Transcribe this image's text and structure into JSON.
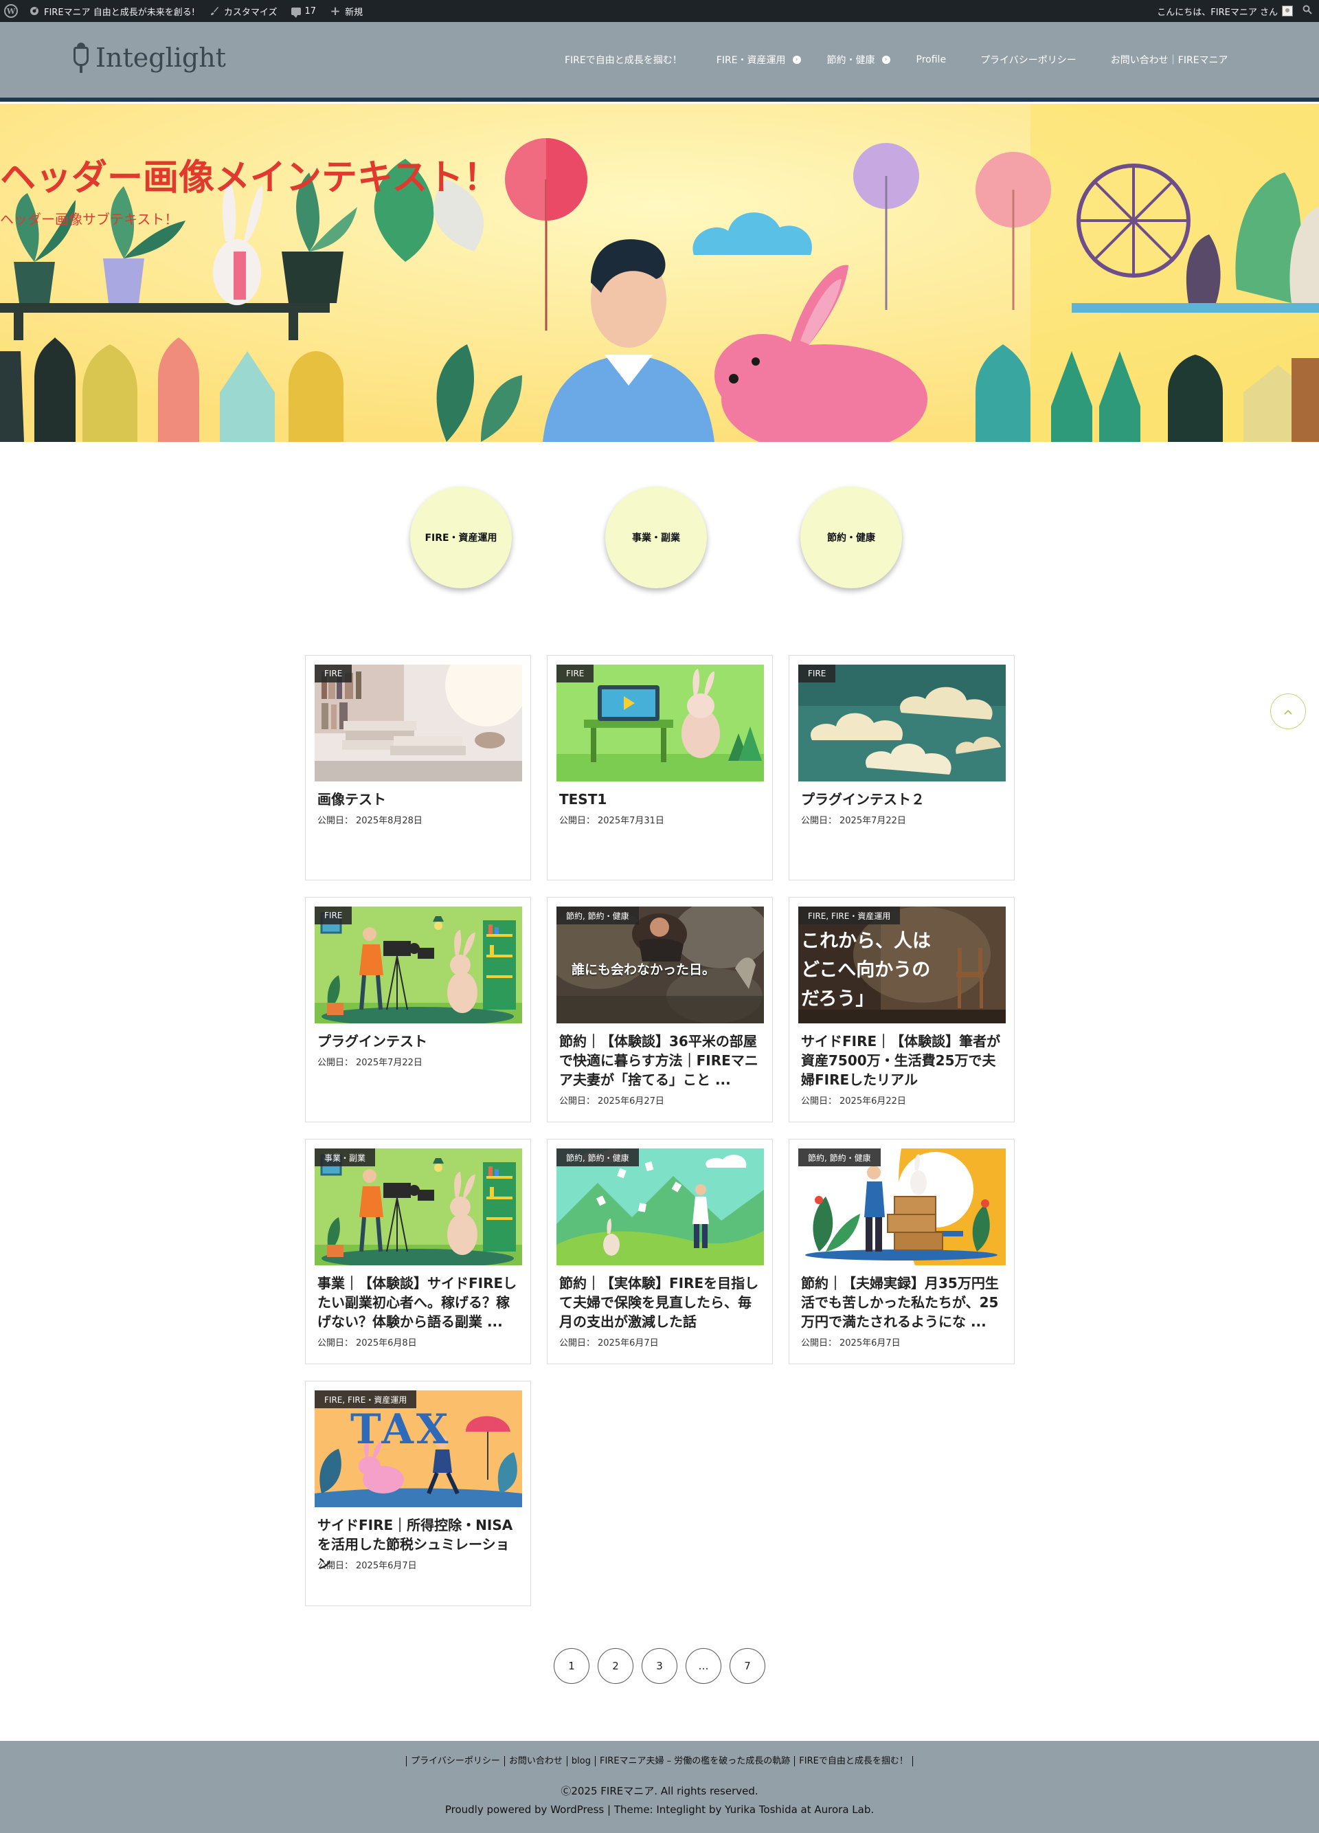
{
  "adminbar": {
    "site_name": "FIREマニア 自由と成長が未来を創る!",
    "customize": "カスタマイズ",
    "comments_count": "17",
    "new_label": "新規",
    "greeting": "こんにちは、FIREマニア さん"
  },
  "header": {
    "logo_text": "Integlight",
    "nav": [
      {
        "label": "FIREで自由と成長を掴む！"
      },
      {
        "label": "FIRE・資産運用"
      },
      {
        "label": "節約・健康"
      },
      {
        "label": "Profile"
      },
      {
        "label": "プライバシーポリシー"
      },
      {
        "label": "お問い合わせ｜FIREマニア"
      }
    ]
  },
  "hero": {
    "title": "ヘッダー画像メインテキスト！",
    "subtitle": "ヘッダー画像サブテキスト！"
  },
  "categories": [
    {
      "label": "FIRE・資産運用"
    },
    {
      "label": "事業・副業"
    },
    {
      "label": "節約・健康"
    }
  ],
  "posts": [
    {
      "category": "FIRE",
      "title": "画像テスト",
      "date_label": "公開日：",
      "date": "2025年8月28日",
      "thumb": "books"
    },
    {
      "category": "FIRE",
      "title": "TEST1",
      "date_label": "公開日：",
      "date": "2025年7月31日",
      "thumb": "rabbit-desk"
    },
    {
      "category": "FIRE",
      "title": "プラグインテスト２",
      "date_label": "公開日：",
      "date": "2025年7月22日",
      "thumb": "clouds"
    },
    {
      "category": "FIRE",
      "title": "プラグインテスト",
      "date_label": "公開日：",
      "date": "2025年7月22日",
      "thumb": "camera-rabbit"
    },
    {
      "category": "節約, 節約・健康",
      "title": "節約｜【体験談】36平米の部屋で快適に暮らす方法｜FIREマニア夫妻が「捨てる」こと ...",
      "date_label": "公開日：",
      "date": "2025年6月27日",
      "thumb": "dark-photo",
      "thumb_text": "誰にも会わなかった日。"
    },
    {
      "category": "FIRE, FIRE・資産運用",
      "title": "サイドFIRE｜【体験談】筆者が資産7500万・生活費25万で夫婦FIREしたリアル",
      "date_label": "公開日：",
      "date": "2025年6月22日",
      "thumb": "brown-room",
      "thumb_text": "これから、人はどこへ向かうのだろう」"
    },
    {
      "category": "事業・副業",
      "title": "事業｜【体験談】サイドFIREしたい副業初心者へ。稼げる？稼げない？体験から語る副業 ...",
      "date_label": "公開日：",
      "date": "2025年6月8日",
      "thumb": "camera-rabbit"
    },
    {
      "category": "節約, 節約・健康",
      "title": "節約｜【実体験】FIREを目指して夫婦で保険を見直したら、毎月の支出が激減した話",
      "date_label": "公開日：",
      "date": "2025年6月7日",
      "thumb": "papers"
    },
    {
      "category": "節約, 節約・健康",
      "title": "節約｜【夫婦実録】月35万円生活でも苦しかった私たちが、25万円で満たされるようにな ...",
      "date_label": "公開日：",
      "date": "2025年6月7日",
      "thumb": "boxes"
    },
    {
      "category": "FIRE, FIRE・資産運用",
      "title": "サイドFIRE｜所得控除・NISAを活用した節税シュミレーション",
      "date_label": "公開日：",
      "date": "2025年6月7日",
      "thumb": "tax",
      "thumb_text": "TAX"
    }
  ],
  "pagination": [
    "1",
    "2",
    "3",
    "…",
    "7"
  ],
  "footer": {
    "links": [
      "プライバシーポリシー",
      "お問い合わせ",
      "blog",
      "FIREマニア夫婦 – 労働の檻を破った成長の軌跡",
      "FIREで自由と成長を掴む！"
    ],
    "copyright": "Ⓒ2025 FIREマニア. All rights reserved.",
    "powered": "Proudly powered by WordPress | Theme: Integlight by Yurika Toshida at Aurora Lab."
  },
  "colors": {
    "header_bg": "#94a0a8",
    "hero_text": "#e03a2f",
    "circle_bg": "#f6f9c9",
    "adminbar_bg": "#1d2327"
  }
}
